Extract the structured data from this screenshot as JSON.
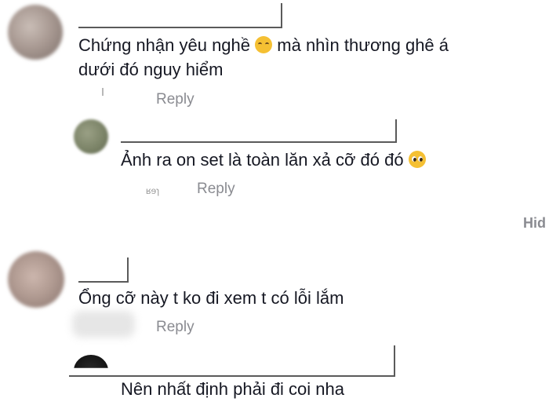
{
  "comments": [
    {
      "text_line1": "Chứng nhận yêu nghề",
      "text_line1_after_emoji": "mà nhìn thương ghê á",
      "text_line2": "dưới đó nguy hiểm",
      "emoji": "loudly-crying-face",
      "reply_label": "Reply"
    },
    {
      "text": "Ảnh ra on set là toàn lăn xả cỡ đó đó",
      "emoji": "pleading-face",
      "faint_text": "ʁɘɿ",
      "reply_label": "Reply"
    },
    {
      "hide_label": "Hid"
    },
    {
      "text": "Ổng cỡ này t ko đi xem t có lỗi lắm",
      "reply_label": "Reply"
    },
    {
      "text": "Nên nhất định phải đi coi nha"
    }
  ],
  "colors": {
    "text": "#161823",
    "muted": "#8a8b91",
    "emoji": "#f5c033"
  }
}
